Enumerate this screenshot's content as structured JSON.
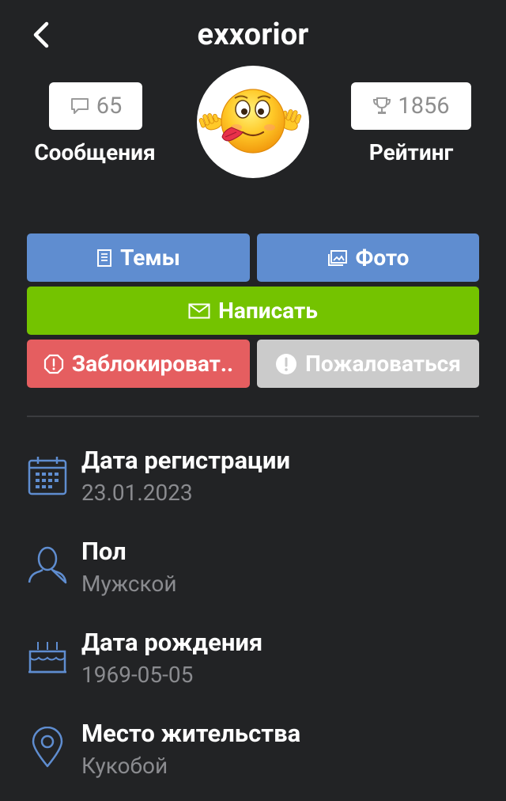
{
  "header": {
    "title": "exxorior",
    "back_icon": "chevron-left-icon"
  },
  "stats": {
    "messages": {
      "count": "65",
      "label": "Сообщения",
      "icon": "comment-icon"
    },
    "rating": {
      "count": "1856",
      "label": "Рейтинг",
      "icon": "trophy-icon"
    }
  },
  "avatar": {
    "icon": "emoji-tongue-avatar"
  },
  "actions": {
    "topics": "Темы",
    "photo": "Фото",
    "write": "Написать",
    "block": "Заблокироват..",
    "report": "Пожаловаться"
  },
  "info": [
    {
      "title": "Дата регистрации",
      "value": "23.01.2023",
      "icon": "calendar-icon"
    },
    {
      "title": "Пол",
      "value": "Мужской",
      "icon": "user-icon"
    },
    {
      "title": "Дата рождения",
      "value": "1969-05-05",
      "icon": "cake-icon"
    },
    {
      "title": "Место жительства",
      "value": "Кукобой",
      "icon": "location-pin-icon"
    }
  ],
  "colors": {
    "background": "#222325",
    "primary_button": "#5f8dd0",
    "write_button": "#74c300",
    "block_button": "#e55e60",
    "report_button": "#cbcbcb",
    "icon_accent": "#5f8dd0",
    "secondary_text": "#8a8b8f"
  }
}
